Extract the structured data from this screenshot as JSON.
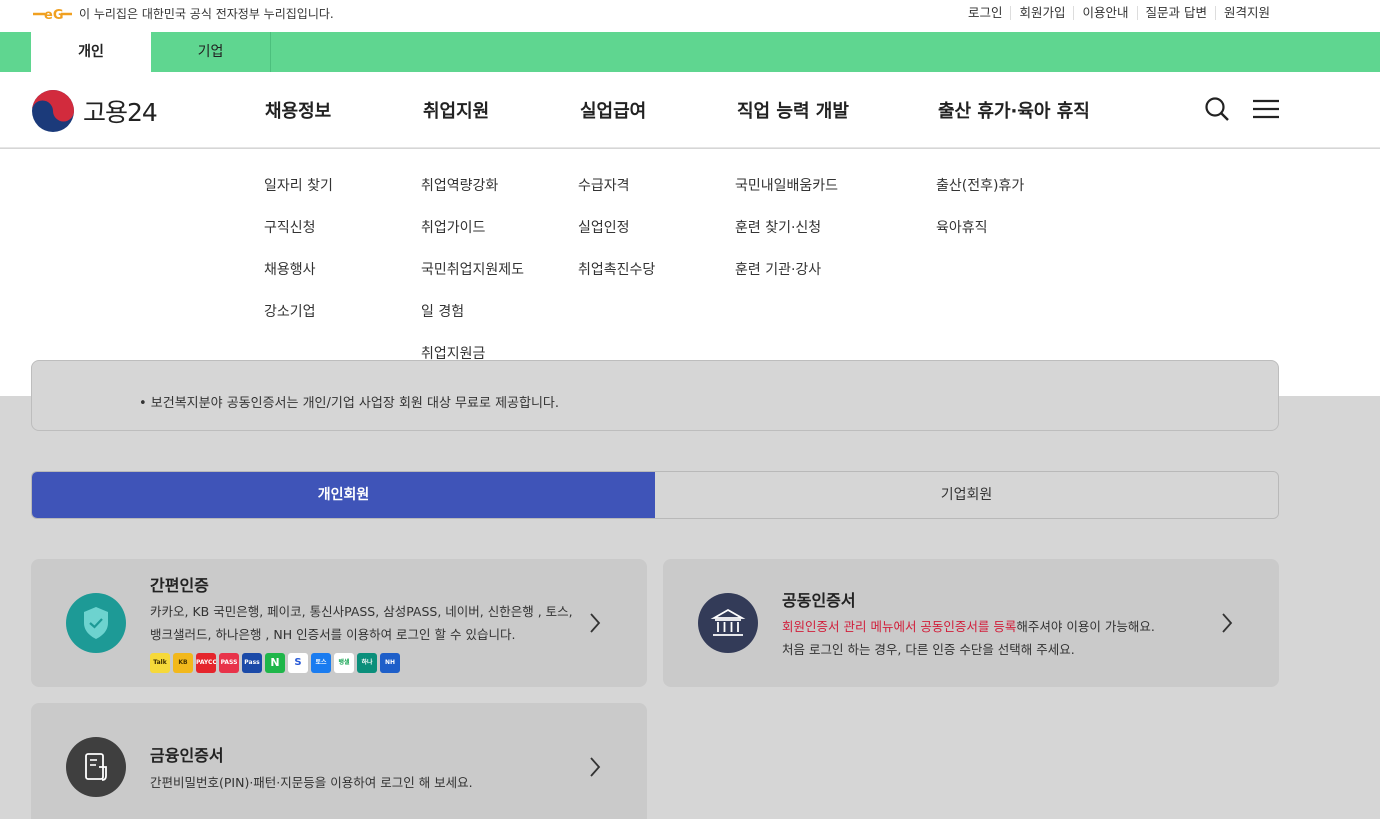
{
  "gov_notice": "이 누리집은 대한민국 공식 전자정부 누리집입니다.",
  "util_links": [
    "로그인",
    "회원가입",
    "이용안내",
    "질문과 답변",
    "원격지원"
  ],
  "tabs": [
    {
      "label": "개인",
      "active": true
    },
    {
      "label": "기업",
      "active": false
    }
  ],
  "logo_text": "고용24",
  "gnb": [
    "채용정보",
    "취업지원",
    "실업급여",
    "직업 능력 개발",
    "출산 휴가·육아 휴직"
  ],
  "mega_menu": [
    [
      "일자리 찾기",
      "구직신청",
      "채용행사",
      "강소기업"
    ],
    [
      "취업역량강화",
      "취업가이드",
      "국민취업지원제도",
      "일 경험",
      "취업지원금"
    ],
    [
      "수급자격",
      "실업인정",
      "취업촉진수당"
    ],
    [
      "국민내일배움카드",
      "훈련 찾기·신청",
      "훈련 기관·강사"
    ],
    [
      "출산(전후)휴가",
      "육아휴직"
    ]
  ],
  "notice_text": "• 보건복지분야 공동인증서는 개인/기업 사업장 회원 대상 무료로 제공합니다.",
  "member_tabs": {
    "personal": "개인회원",
    "business": "기업회원"
  },
  "cards": {
    "simple": {
      "title": "간편인증",
      "desc1": "카카오, KB 국민은행, 페이코, 통신사PASS, 삼성PASS, 네이버, 신한은행 , 토스,",
      "desc2": "뱅크샐러드, 하나은행 , NH 인증서를 이용하여 로그인 할 수 있습니다.",
      "badges": [
        "Talk",
        "KB",
        "PAYCO",
        "PASS",
        "Pass",
        "N",
        "S",
        "토스",
        "뱅샐",
        "하나",
        "NH"
      ]
    },
    "joint": {
      "title": "공동인증서",
      "desc_red": "회원인증서 관리 메뉴에서 공동인증서를 등록",
      "desc_rest": "해주셔야 이용이 가능해요.",
      "desc2": "처음 로그인 하는 경우, 다른 인증 수단을 선택해 주세요."
    },
    "finance": {
      "title": "금융인증서",
      "desc": "간편비밀번호(PIN)·패턴·지문등을 이용하여 로그인 해 보세요."
    }
  },
  "colors": {
    "green_bar": "#5fd690",
    "tab_active": "#3f54b8",
    "teal_icon": "#1d9a96",
    "navy_icon": "#333b58",
    "dark_icon": "#3f3f3f"
  }
}
